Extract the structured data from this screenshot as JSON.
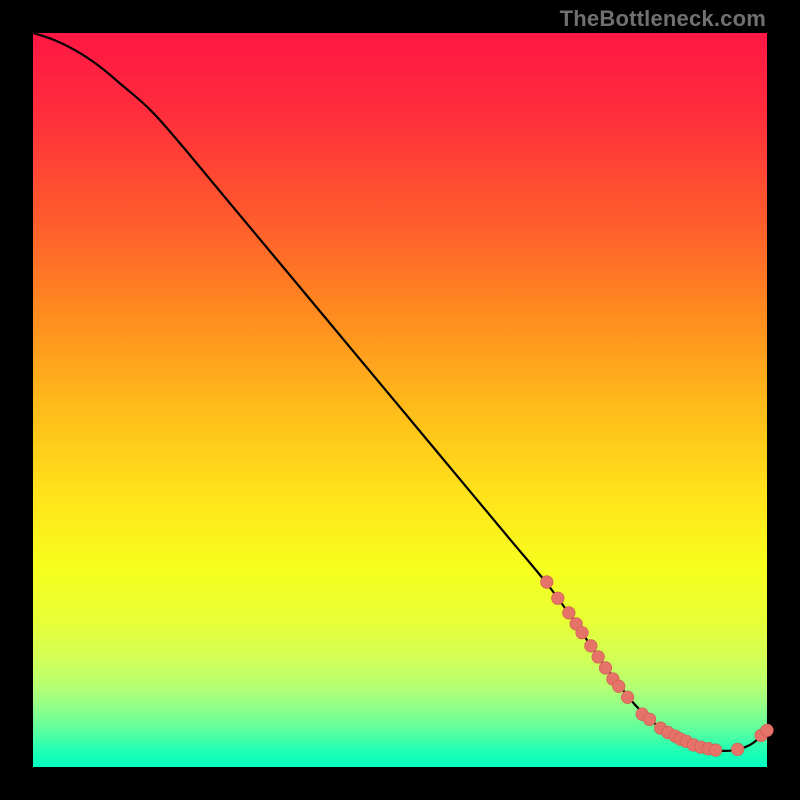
{
  "watermark": "TheBottleneck.com",
  "colors": {
    "dot_fill": "#e57368",
    "dot_stroke": "#cc5a50",
    "curve": "#000000"
  },
  "chart_data": {
    "type": "line",
    "title": "",
    "xlabel": "",
    "ylabel": "",
    "xlim": [
      0,
      100
    ],
    "ylim": [
      0,
      100
    ],
    "grid": false,
    "legend_position": "none",
    "series": [
      {
        "name": "curve",
        "x": [
          0,
          3,
          6,
          9,
          12,
          16,
          20,
          25,
          30,
          35,
          40,
          45,
          50,
          55,
          60,
          65,
          70,
          74,
          77,
          80,
          82,
          84,
          86,
          88,
          90,
          92,
          94,
          96,
          98,
          100
        ],
        "y": [
          100,
          99,
          97.5,
          95.5,
          93,
          89.5,
          85,
          79,
          73,
          67,
          61,
          55,
          49,
          43,
          37,
          31,
          25,
          19.5,
          15,
          11,
          8.5,
          6.5,
          5,
          3.8,
          3,
          2.5,
          2.2,
          2.4,
          3.2,
          5
        ]
      }
    ],
    "dots": {
      "name": "highlight-points",
      "x": [
        70,
        71.5,
        73,
        74,
        74.8,
        76,
        77,
        78,
        79,
        79.8,
        81,
        83,
        84,
        85.5,
        86.5,
        87.5,
        88.2,
        89,
        90,
        91,
        92,
        93,
        96,
        99.2,
        100
      ],
      "y": [
        25.2,
        23,
        21,
        19.5,
        18.3,
        16.5,
        15,
        13.5,
        12,
        11,
        9.5,
        7.2,
        6.5,
        5.3,
        4.7,
        4.2,
        3.8,
        3.5,
        3,
        2.7,
        2.5,
        2.3,
        2.4,
        4.3,
        5
      ]
    }
  }
}
